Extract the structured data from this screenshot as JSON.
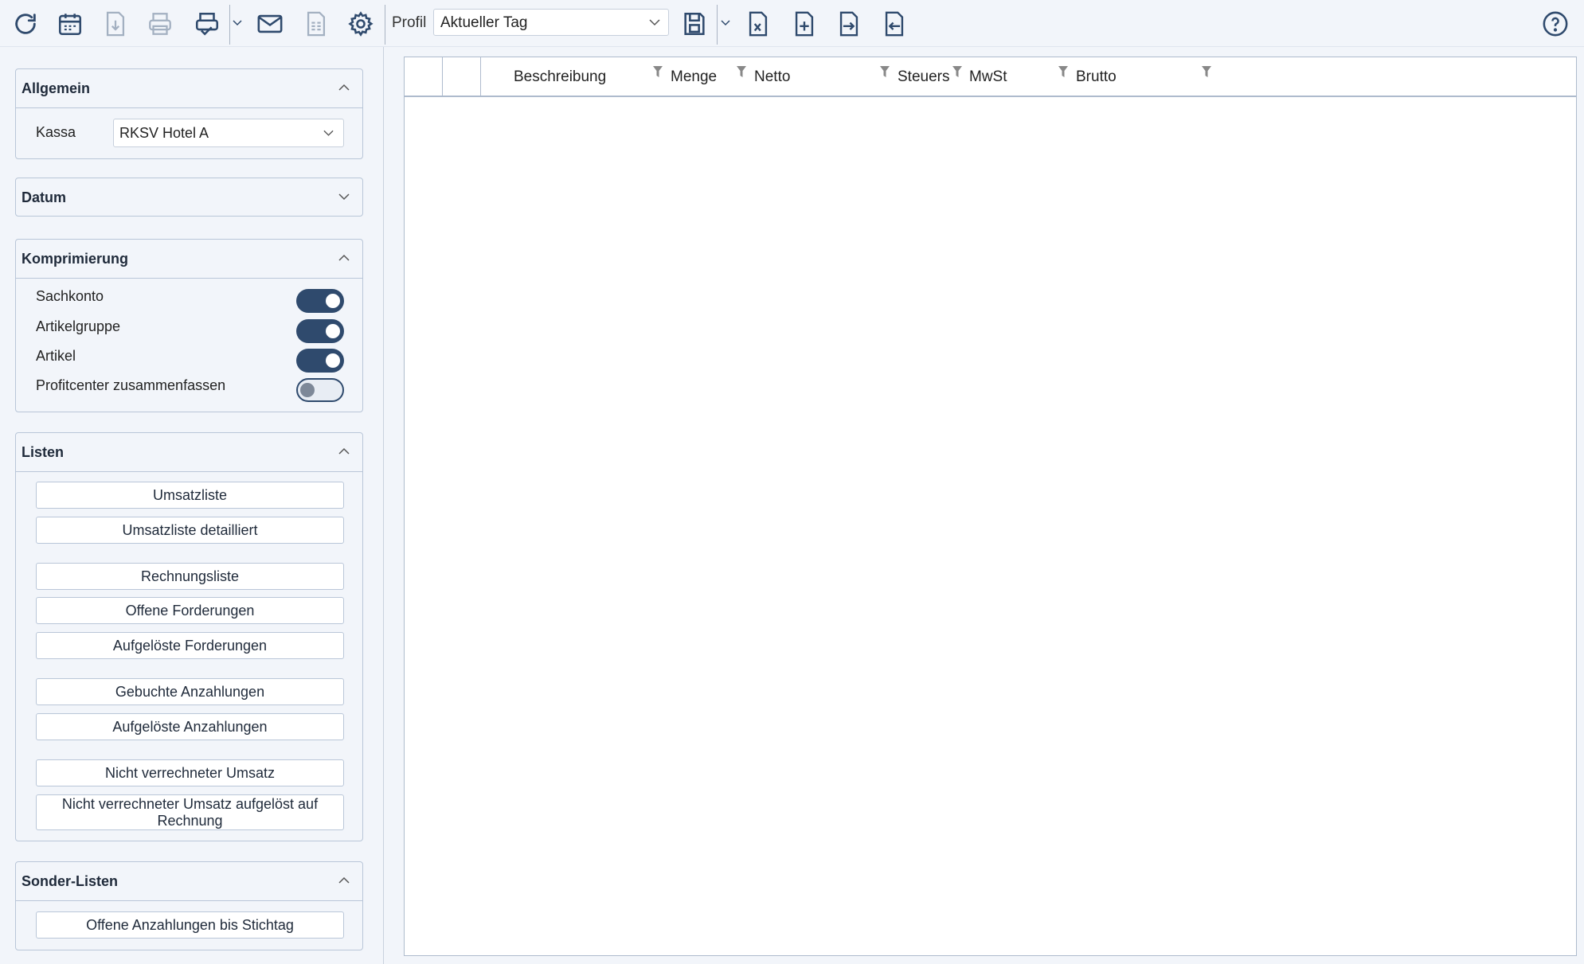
{
  "toolbar": {
    "icons": [
      "refresh-icon",
      "calendar-icon",
      "download-document-icon",
      "printer-icon",
      "print-menu-icon",
      "mail-icon",
      "report-document-icon",
      "gear-icon",
      "save-icon",
      "export-excel-icon",
      "new-document-icon",
      "import-icon",
      "export-icon",
      "help-icon"
    ],
    "profil_label": "Profil",
    "profil_value": "Aktueller Tag"
  },
  "sidebar": {
    "allgemein": {
      "title": "Allgemein",
      "kassa_label": "Kassa",
      "kassa_value": "RKSV Hotel A"
    },
    "datum": {
      "title": "Datum"
    },
    "komprimierung": {
      "title": "Komprimierung",
      "toggles": [
        {
          "label": "Sachkonto",
          "on": true
        },
        {
          "label": "Artikelgruppe",
          "on": true
        },
        {
          "label": "Artikel",
          "on": true
        },
        {
          "label": "Profitcenter zusammenfassen",
          "on": false
        }
      ]
    },
    "listen": {
      "title": "Listen",
      "buttons": [
        "Umsatzliste",
        "Umsatzliste detailliert",
        "Rechnungsliste",
        "Offene Forderungen",
        "Aufgelöste Forderungen",
        "Gebuchte Anzahlungen",
        "Aufgelöste Anzahlungen",
        "Nicht verrechneter Umsatz",
        "Nicht verrechneter Umsatz aufgelöst auf Rechnung"
      ]
    },
    "sonder_listen": {
      "title": "Sonder-Listen",
      "buttons": [
        "Offene Anzahlungen bis Stichtag"
      ]
    }
  },
  "grid": {
    "columns": [
      "Beschreibung",
      "Menge",
      "Netto",
      "Steuers",
      "MwSt",
      "Brutto"
    ],
    "rows": []
  },
  "colors": {
    "accent": "#2f4a6d",
    "border": "#b9c6d8",
    "background": "#f2f5fa"
  }
}
